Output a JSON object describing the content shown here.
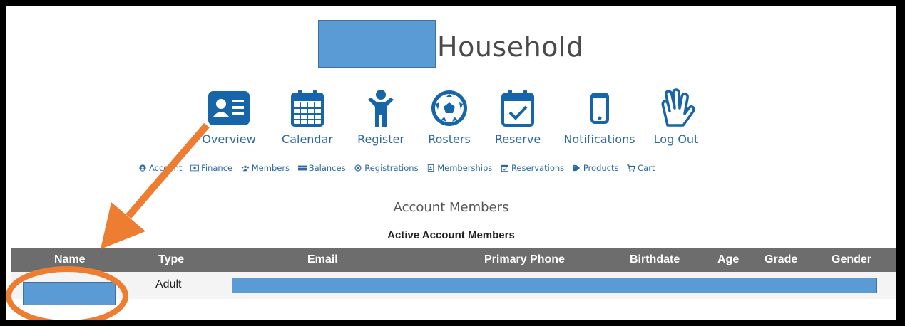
{
  "header": {
    "title": "Household"
  },
  "main_nav": {
    "items": [
      {
        "label": "Overview",
        "icon": "id-card-icon"
      },
      {
        "label": "Calendar",
        "icon": "calendar-icon"
      },
      {
        "label": "Register",
        "icon": "person-icon"
      },
      {
        "label": "Rosters",
        "icon": "soccer-ball-icon"
      },
      {
        "label": "Reserve",
        "icon": "calendar-check-icon"
      },
      {
        "label": "Notifications",
        "icon": "phone-icon"
      },
      {
        "label": "Log Out",
        "icon": "waving-hand-icon"
      }
    ]
  },
  "sub_nav": {
    "items": [
      {
        "label": "Account",
        "icon": "user-circle-icon"
      },
      {
        "label": "Finance",
        "icon": "money-icon"
      },
      {
        "label": "Members",
        "icon": "users-icon"
      },
      {
        "label": "Balances",
        "icon": "credit-card-icon"
      },
      {
        "label": "Registrations",
        "icon": "soccer-ball-icon"
      },
      {
        "label": "Memberships",
        "icon": "badge-icon"
      },
      {
        "label": "Reservations",
        "icon": "calendar-check-icon"
      },
      {
        "label": "Products",
        "icon": "tags-icon"
      },
      {
        "label": "Cart",
        "icon": "cart-icon"
      }
    ]
  },
  "main": {
    "section_title": "Account Members",
    "table_caption": "Active Account Members",
    "columns": [
      "Name",
      "Type",
      "Email",
      "Primary Phone",
      "Birthdate",
      "Age",
      "Grade",
      "Gender"
    ],
    "rows": [
      {
        "name": "",
        "type": "Adult",
        "email": "",
        "primary_phone": "",
        "birthdate": "",
        "age": "",
        "grade": "",
        "gender": ""
      }
    ]
  },
  "colors": {
    "accent": "#1565a8",
    "redaction": "#5b9bd5",
    "annotation": "#ed7d31",
    "table_header": "#6d6d6d"
  }
}
